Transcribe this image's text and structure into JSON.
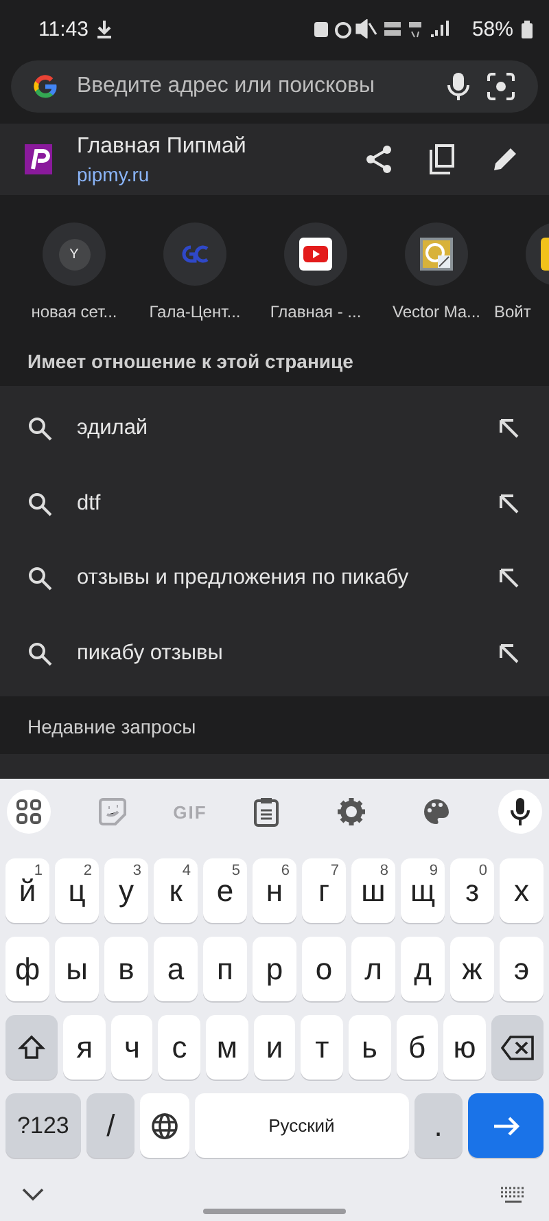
{
  "status_bar": {
    "time": "11:43",
    "battery": "58%"
  },
  "search": {
    "placeholder": "Введите адрес или поисковы"
  },
  "page": {
    "title": "Главная Пипмай",
    "url": "pipmy.ru"
  },
  "shortcuts": [
    {
      "kind": "letter",
      "letter": "Y",
      "label": "новая сет..."
    },
    {
      "kind": "rings",
      "label": "Гала-Цент..."
    },
    {
      "kind": "video",
      "label": "Главная - ..."
    },
    {
      "kind": "chart",
      "label": "Vector Ma..."
    },
    {
      "kind": "tile",
      "label": "Войт"
    }
  ],
  "related_header": "Имеет отношение к этой странице",
  "suggestions": [
    "эдилай",
    "dtf",
    "отзывы и предложения по пикабу",
    "пикабу отзывы"
  ],
  "recent_header": "Недавние запросы",
  "keyboard": {
    "toolbar": [
      {
        "kind": "grid",
        "disabled": false
      },
      {
        "kind": "sticker",
        "disabled": true
      },
      {
        "kind": "gif",
        "label": "GIF",
        "disabled": true
      },
      {
        "kind": "clipboard",
        "disabled": false
      },
      {
        "kind": "settings",
        "disabled": false
      },
      {
        "kind": "palette",
        "disabled": false
      },
      {
        "kind": "mic",
        "disabled": false
      }
    ],
    "row1": [
      {
        "key": "й",
        "hint": "1"
      },
      {
        "key": "ц",
        "hint": "2"
      },
      {
        "key": "у",
        "hint": "3"
      },
      {
        "key": "к",
        "hint": "4"
      },
      {
        "key": "е",
        "hint": "5"
      },
      {
        "key": "н",
        "hint": "6"
      },
      {
        "key": "г",
        "hint": "7"
      },
      {
        "key": "ш",
        "hint": "8"
      },
      {
        "key": "щ",
        "hint": "9"
      },
      {
        "key": "з",
        "hint": "0"
      },
      {
        "key": "х"
      }
    ],
    "row2": [
      "ф",
      "ы",
      "в",
      "а",
      "п",
      "р",
      "о",
      "л",
      "д",
      "ж",
      "э"
    ],
    "row3": [
      "я",
      "ч",
      "с",
      "м",
      "и",
      "т",
      "ь",
      "б",
      "ю"
    ],
    "symbols_key": "?123",
    "slash_key": "/",
    "space_key": "Русский",
    "period_key": "."
  }
}
